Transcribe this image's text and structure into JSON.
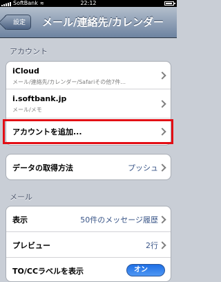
{
  "status_bar": {
    "carrier": "SoftBank",
    "time": "22:12",
    "battery_level": 0.9
  },
  "nav": {
    "back_label": "設定",
    "title": "メール/連絡先/カレンダー"
  },
  "accounts_section": {
    "header": "アカウント",
    "items": [
      {
        "title": "iCloud",
        "subtitle": "メール/連絡先/カレンダー/Safariその他7件..."
      },
      {
        "title": "i.softbank.jp",
        "subtitle": "メール/メモ"
      },
      {
        "title": "アカウントを追加..."
      }
    ]
  },
  "fetch_section": {
    "label": "データの取得方法",
    "value": "プッシュ"
  },
  "mail_section": {
    "header": "メール",
    "items": [
      {
        "title": "表示",
        "value": "50件のメッセージ履歴"
      },
      {
        "title": "プレビュー",
        "value": "2行"
      },
      {
        "title": "TO/CCラベルを表示",
        "toggle": "オン"
      }
    ]
  }
}
